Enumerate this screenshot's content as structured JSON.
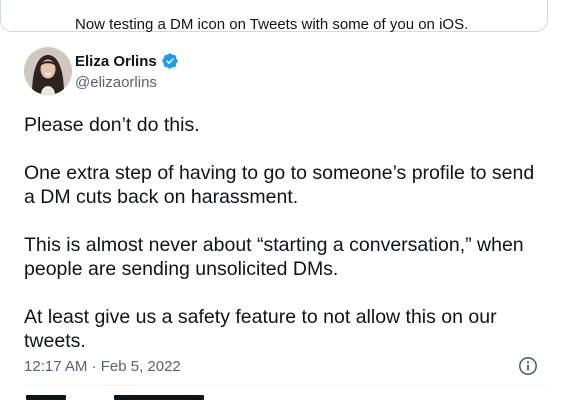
{
  "quoted_tweet": {
    "text": "Now testing a DM icon on Tweets with some of you on iOS."
  },
  "author": {
    "name": "Eliza Orlins",
    "handle": "@elizaorlins",
    "verified": true,
    "avatar_icon": "user-photo-avatar"
  },
  "tweet": {
    "paragraphs": [
      "Please don’t do this.",
      "One extra step of having to go to someone’s profile to send a DM cuts back on harassment.",
      "This is almost never about “starting a conversation,” when people are sending unsolicited DMs.",
      "At least give us a safety feature to not allow this on our tweets."
    ],
    "timestamp": "12:17 AM · Feb 5, 2022"
  },
  "colors": {
    "text": "#0f1419",
    "muted": "#536471",
    "verified": "#1d9bf0",
    "border": "#cfd9de"
  }
}
